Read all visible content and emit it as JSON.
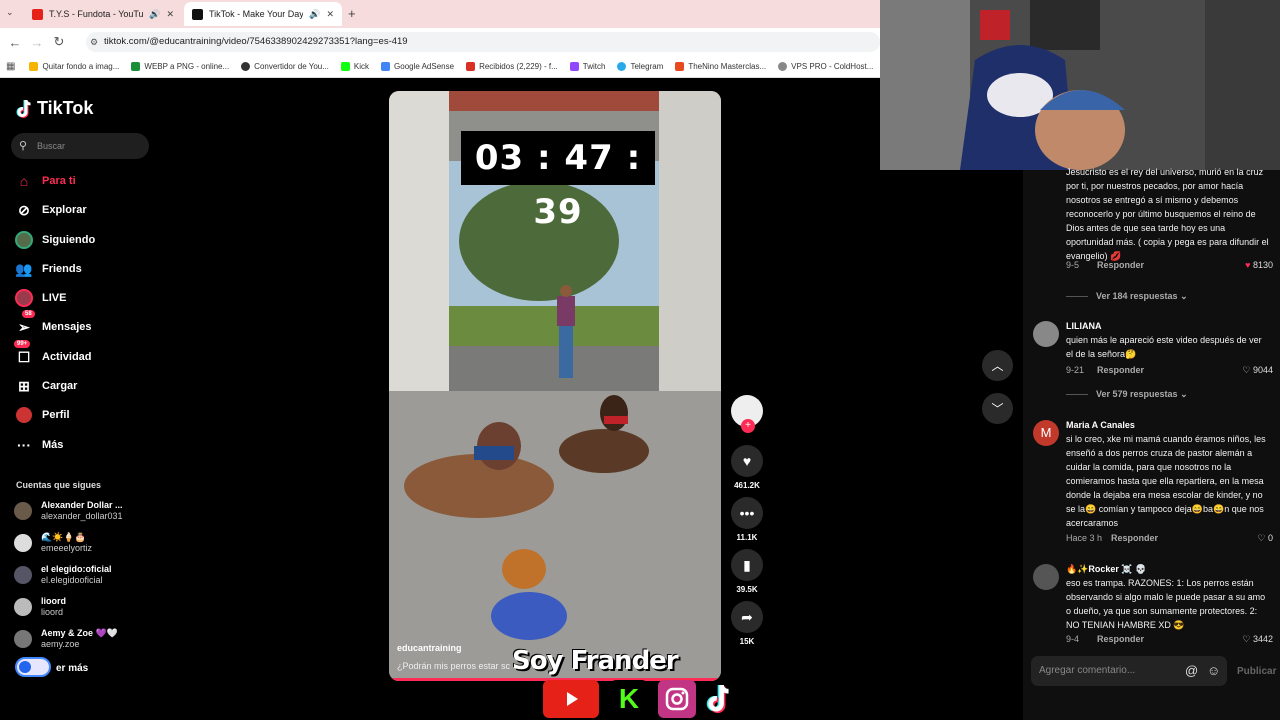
{
  "browser": {
    "tabs": [
      {
        "title": "T.Y.S - Fundota - YouTube",
        "active": false
      },
      {
        "title": "TikTok - Make Your Day",
        "active": true
      }
    ],
    "url": "tiktok.com/@educantraining/video/7546338902429273351?lang=es-419",
    "bookmarks": [
      "Quitar fondo a imag...",
      "WEBP a PNG - online...",
      "Convertidor de You...",
      "Kick",
      "Google AdSense",
      "Recibidos (2,229) - f...",
      "Twitch",
      "Telegram",
      "TheNino Masterclas...",
      "VPS PRO - ColdHost..."
    ]
  },
  "sidebar": {
    "logo": "TikTok",
    "search_placeholder": "Buscar",
    "nav": [
      {
        "label": "Para ti",
        "icon": "home-icon"
      },
      {
        "label": "Explorar",
        "icon": "compass-icon"
      },
      {
        "label": "Siguiendo",
        "icon": "following-avatar-icon"
      },
      {
        "label": "Friends",
        "icon": "friends-icon"
      },
      {
        "label": "LIVE",
        "icon": "live-icon"
      },
      {
        "label": "Mensajes",
        "icon": "message-icon",
        "badge": "58"
      },
      {
        "label": "Actividad",
        "icon": "activity-icon",
        "badge": "99+"
      },
      {
        "label": "Cargar",
        "icon": "upload-icon"
      },
      {
        "label": "Perfil",
        "icon": "profile-icon"
      },
      {
        "label": "Más",
        "icon": "more-icon"
      }
    ],
    "following_title": "Cuentas que sigues",
    "accounts": [
      {
        "name": "Alexander Dollar ...",
        "handle": "alexander_dollar031"
      },
      {
        "name": "🌊☀️🍦🎂",
        "handle": "emeeelyortiz"
      },
      {
        "name": "el elegido:oficial",
        "handle": "el.elegidooficial"
      },
      {
        "name": "lioord",
        "handle": "lioord"
      },
      {
        "name": "Aemy & Zoe 💜🤍",
        "handle": "aemy.zoe"
      }
    ],
    "see_more": "er más"
  },
  "video": {
    "timer": "03 : 47 : 39",
    "username": "educantraining",
    "description": "¿Podrán mis perros estar sc",
    "overlay_brand": "Soy Frander"
  },
  "actions": {
    "likes": "461.2K",
    "comments": "11.1K",
    "saves": "39.5K",
    "shares": "15K"
  },
  "comments": {
    "top_partial": {
      "text": "Jesucristo es el rey del universo, murió en la cruz por ti, por nuestros pecados, por amor hacía nosotros se entregó a sí mismo y debemos reconocerlo y por último busquemos el reino de Dios antes de que sea tarde hoy es una oportunidad más. ( copia y pega es para difundir el evangelio) 💋",
      "date": "9-5",
      "reply": "Responder",
      "likes": "8130",
      "view_replies": "Ver 184 respuestas"
    },
    "items": [
      {
        "user": "LILIANA",
        "text": "quien más le apareció este video después de ver el de la señora🤔",
        "date": "9-21",
        "reply": "Responder",
        "likes": "9044",
        "view_replies": "Ver 579 respuestas"
      },
      {
        "user": "Maria A Canales",
        "avatar_letter": "M",
        "text": "si lo creo, xke mi mamá cuando éramos niños, les enseñó a dos perros cruza de pastor alemán a cuidar la comida, para que nosotros no la comieramos hasta que ella repartiera, en la mesa donde la dejaba era mesa escolar de kinder, y no se la😄 comían y tampoco deja😄ba😄n que nos acercaramos",
        "date": "Hace 3 h",
        "reply": "Responder",
        "likes": "0"
      },
      {
        "user": "🔥✨Rocker ☠️ 💀",
        "text": "eso es trampa. RAZONES: 1: Los perros están observando si algo malo le puede pasar a su amo o dueño, ya que son sumamente protectores. 2: NO TENIAN HAMBRE XD 😎",
        "date": "9-4",
        "reply": "Responder",
        "likes": "3442"
      }
    ],
    "input_placeholder": "Agregar comentario...",
    "post_label": "Publicar"
  },
  "colors": {
    "accent": "#fe2c55"
  }
}
